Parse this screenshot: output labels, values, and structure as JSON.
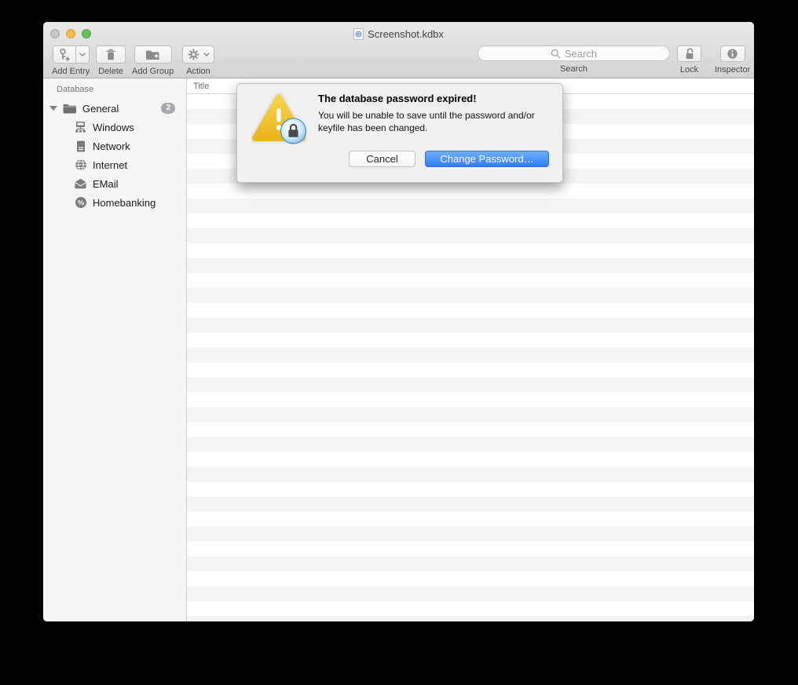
{
  "window": {
    "title": "Screenshot.kdbx",
    "traffic_lights": [
      "close-disabled",
      "minimize",
      "zoom"
    ]
  },
  "toolbar": {
    "add_entry_label": "Add Entry",
    "delete_label": "Delete",
    "add_group_label": "Add Group",
    "action_label": "Action",
    "search_label": "Search",
    "search_placeholder": "Search",
    "lock_label": "Lock",
    "inspector_label": "Inspector",
    "icons": [
      "key-plus-icon",
      "chevron-down-icon",
      "trash-icon",
      "folder-plus-icon",
      "gear-icon",
      "search-icon",
      "lock-open-icon",
      "info-icon"
    ]
  },
  "sidebar": {
    "header": "Database",
    "root": {
      "label": "General",
      "badge": "2",
      "icon": "folder-icon"
    },
    "items": [
      {
        "label": "Windows",
        "icon": "windows-network-icon"
      },
      {
        "label": "Network",
        "icon": "server-icon"
      },
      {
        "label": "Internet",
        "icon": "globe-icon"
      },
      {
        "label": "EMail",
        "icon": "envelope-icon"
      },
      {
        "label": "Homebanking",
        "icon": "percent-icon"
      }
    ]
  },
  "entry_list": {
    "columns": [
      "Title"
    ],
    "rows": []
  },
  "dialog": {
    "icon": "warning-lock-icon",
    "title": "The database password expired!",
    "message": "You will be unable to save until the password and/or keyfile has been changed.",
    "cancel_label": "Cancel",
    "confirm_label": "Change Password…"
  },
  "colors": {
    "accent_blue": "#3b82f7",
    "warning_yellow": "#eec63d",
    "traffic_gray": "#c9c8c8",
    "traffic_yellow": "#f5bd4e",
    "traffic_green": "#61c354",
    "sidebar_bg": "#f5f5f5",
    "stripe_gray": "#f4f4f5"
  }
}
